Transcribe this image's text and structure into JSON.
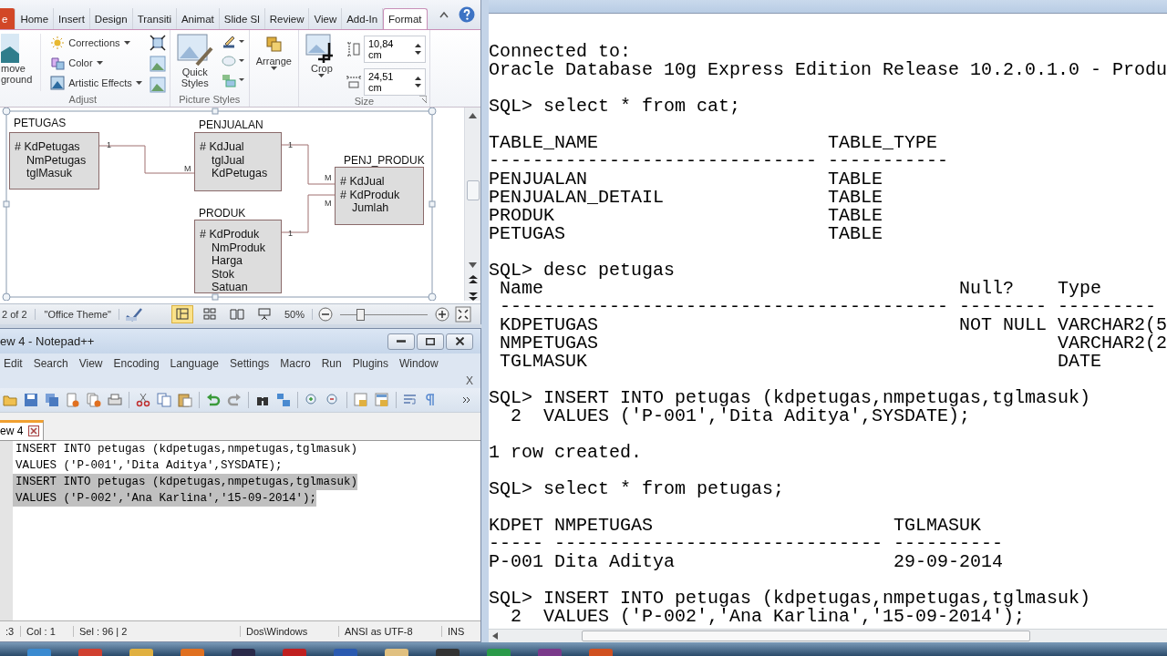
{
  "powerpoint": {
    "ribbon_tabs": [
      {
        "label": "e",
        "kind": "file",
        "selected": false
      },
      {
        "label": "Home",
        "kind": "tab",
        "selected": false
      },
      {
        "label": "Insert",
        "kind": "tab",
        "selected": false
      },
      {
        "label": "Design",
        "kind": "tab",
        "selected": false
      },
      {
        "label": "Transiti",
        "kind": "tab",
        "selected": false
      },
      {
        "label": "Animat",
        "kind": "tab",
        "selected": false
      },
      {
        "label": "Slide Sl",
        "kind": "tab",
        "selected": false
      },
      {
        "label": "Review",
        "kind": "tab",
        "selected": false
      },
      {
        "label": "View",
        "kind": "tab",
        "selected": false
      },
      {
        "label": "Add-In",
        "kind": "tab",
        "selected": false
      },
      {
        "label": "Format",
        "kind": "tab",
        "selected": true
      }
    ],
    "adjust": {
      "label": "Adjust",
      "large_button": [
        "move",
        "ground"
      ],
      "menus": [
        "Corrections",
        "Color",
        "Artistic Effects"
      ]
    },
    "picture_styles": {
      "label": "Picture Styles",
      "quick_styles": [
        "Quick",
        "Styles"
      ]
    },
    "arrange": {
      "label": "Arrange"
    },
    "size": {
      "label": "Size",
      "crop": "Crop",
      "height": "10,84 cm",
      "width": "24,51 cm"
    },
    "diagram": {
      "entities": [
        {
          "name": "PETUGAS",
          "attributes": [
            {
              "text": "# KdPetugas",
              "key": true
            },
            {
              "text": "NmPetugas",
              "key": false
            },
            {
              "text": "tglMasuk",
              "key": false
            }
          ]
        },
        {
          "name": "PENJUALAN",
          "attributes": [
            {
              "text": "# KdJual",
              "key": true
            },
            {
              "text": "tglJual",
              "key": false
            },
            {
              "text": "KdPetugas",
              "key": false
            }
          ]
        },
        {
          "name": "PENJ_PRODUK",
          "attributes": [
            {
              "text": "# KdJual",
              "key": true
            },
            {
              "text": "# KdProduk",
              "key": true
            },
            {
              "text": "Jumlah",
              "key": false
            }
          ]
        },
        {
          "name": "PRODUK",
          "attributes": [
            {
              "text": "# KdProduk",
              "key": true
            },
            {
              "text": "NmProduk",
              "key": false
            },
            {
              "text": "Harga",
              "key": false
            },
            {
              "text": "Stok",
              "key": false
            },
            {
              "text": "Satuan",
              "key": false
            }
          ]
        }
      ],
      "relationships": [
        {
          "one": "1",
          "many": "M"
        },
        {
          "one": "1",
          "many": "M"
        },
        {
          "one": "1",
          "many": "M"
        }
      ]
    },
    "status_bar": {
      "slide": "2 of 2",
      "theme": "\"Office Theme\"",
      "views": [
        {
          "kind": "normal",
          "selected": true
        },
        {
          "kind": "sorter",
          "selected": false
        },
        {
          "kind": "reading",
          "selected": false
        },
        {
          "kind": "show",
          "selected": false
        }
      ],
      "zoom": "50%",
      "zoom_slider": {
        "level": 0.23
      }
    }
  },
  "notepad": {
    "title": "ew 4 - Notepad++",
    "menu": [
      "Edit",
      "Search",
      "View",
      "Encoding",
      "Language",
      "Settings",
      "Macro",
      "Run",
      "Plugins",
      "Window"
    ],
    "close_document": "X",
    "tab": "ew 4",
    "lines": [
      {
        "text": "INSERT INTO petugas (kdpetugas,nmpetugas,tglmasuk)",
        "selected": false
      },
      {
        "text": "VALUES ('P-001','Dita Aditya',SYSDATE);",
        "selected": false
      },
      {
        "text": "INSERT INTO petugas (kdpetugas,nmpetugas,tglmasuk)",
        "selected": true
      },
      {
        "text": "VALUES ('P-002','Ana Karlina','15-09-2014');",
        "selected": true
      }
    ],
    "status": [
      ":3",
      "Col : 1",
      "Sel : 96 | 2",
      "Dos\\Windows",
      "ANSI as UTF-8",
      "INS"
    ]
  },
  "terminal": {
    "blocks": [
      [
        "Connected to:",
        "Oracle Database 10g Express Edition Release 10.2.0.1.0 - Produ"
      ],
      [
        "SQL> select * from cat;"
      ],
      [
        "TABLE_NAME                     TABLE_TYPE",
        "------------------------------ -----------",
        "PENJUALAN                      TABLE",
        "PENJUALAN_DETAIL               TABLE",
        "PRODUK                         TABLE",
        "PETUGAS                        TABLE"
      ],
      [
        "SQL> desc petugas",
        " Name                                      Null?    Type",
        " ----------------------------------------- -------- ---------",
        " KDPETUGAS                                 NOT NULL VARCHAR2(5",
        " NMPETUGAS                                          VARCHAR2(2",
        " TGLMASUK                                           DATE"
      ],
      [
        "SQL> INSERT INTO petugas (kdpetugas,nmpetugas,tglmasuk)",
        "  2  VALUES ('P-001','Dita Aditya',SYSDATE);"
      ],
      [
        "1 row created."
      ],
      [
        "SQL> select * from petugas;"
      ],
      [
        "KDPET NMPETUGAS                      TGLMASUK",
        "----- ------------------------------ ----------",
        "P-001 Dita Aditya                    29-09-2014"
      ],
      [
        "SQL> INSERT INTO petugas (kdpetugas,nmpetugas,tglmasuk)",
        "  2  VALUES ('P-002','Ana Karlina','15-09-2014');"
      ]
    ]
  }
}
